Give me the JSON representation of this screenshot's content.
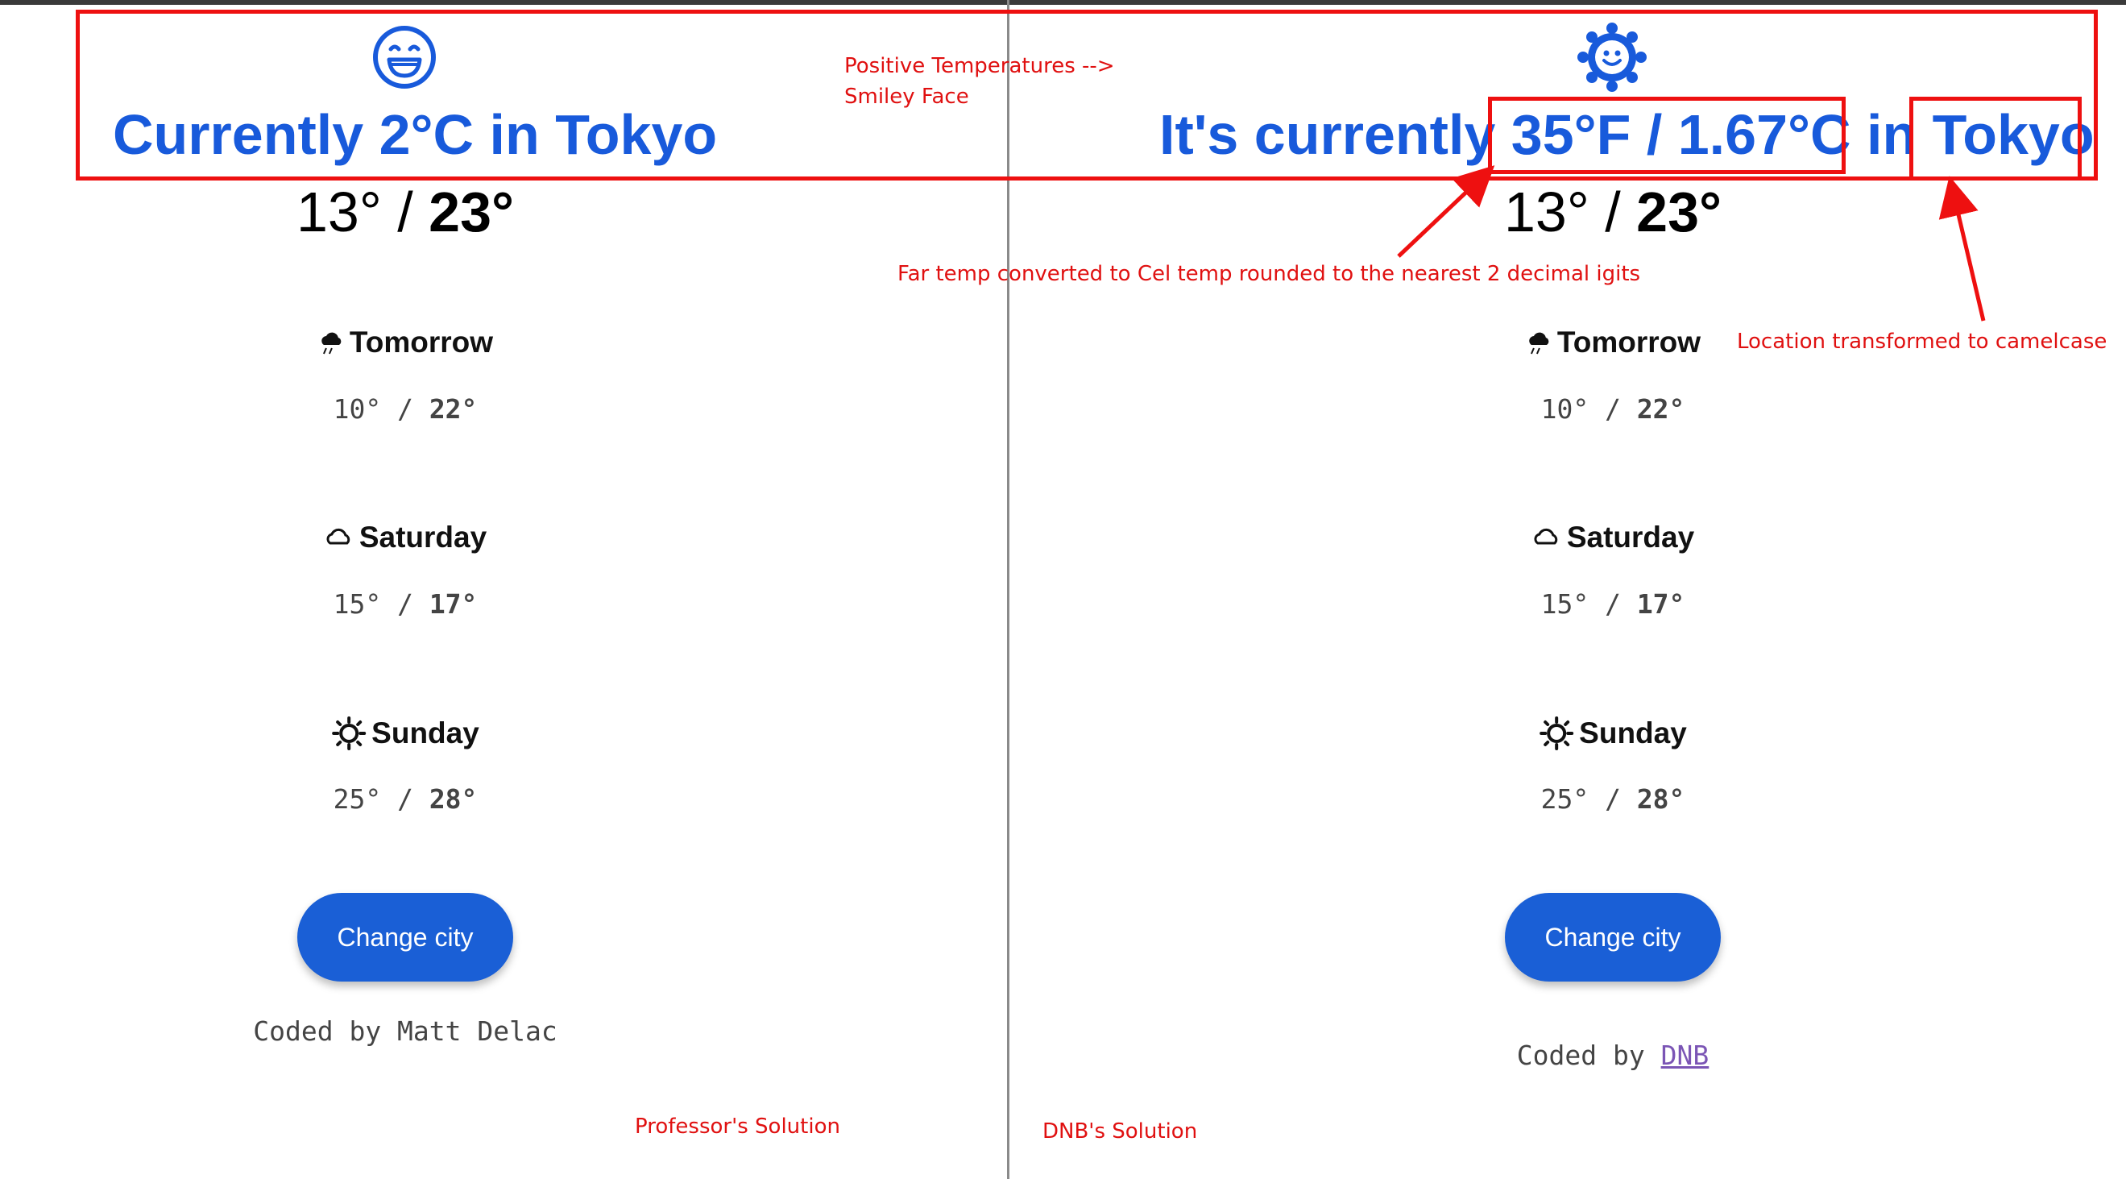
{
  "annotations": {
    "positive_temps": [
      "Positive Temperatures -->",
      "Smiley Face"
    ],
    "conversion_note": "Far temp converted to Cel temp rounded to the nearest 2 decimal igits",
    "location_note": "Location transformed to camelcase",
    "professor_label": "Professor's Solution",
    "dnb_label": "DNB's Solution",
    "color": "#ee1010"
  },
  "left": {
    "icon": "grinning-smiley-icon",
    "headline": "Currently 2°C in Tokyo",
    "today": {
      "low": "13°",
      "sep": "/",
      "high": "23°"
    },
    "forecast": [
      {
        "icon": "rain-cloud-icon",
        "day": "Tomorrow",
        "low": "10°",
        "sep": "/",
        "high": "22°"
      },
      {
        "icon": "cloud-icon",
        "day": "Saturday",
        "low": "15°",
        "sep": "/",
        "high": "17°"
      },
      {
        "icon": "sun-icon",
        "day": "Sunday",
        "low": "25°",
        "sep": "/",
        "high": "28°"
      }
    ],
    "button": "Change city",
    "coded_by": "Coded by Matt Delac"
  },
  "right": {
    "icon": "sun-face-icon",
    "headline_prefix": "It's currently",
    "headline_temp": "35°F / 1.67°C",
    "headline_mid": "in",
    "headline_city": "Tokyo",
    "today": {
      "low": "13°",
      "sep": "/",
      "high": "23°"
    },
    "forecast": [
      {
        "icon": "rain-cloud-icon",
        "day": "Tomorrow",
        "low": "10°",
        "sep": "/",
        "high": "22°"
      },
      {
        "icon": "cloud-icon",
        "day": "Saturday",
        "low": "15°",
        "sep": "/",
        "high": "17°"
      },
      {
        "icon": "sun-icon",
        "day": "Sunday",
        "low": "25°",
        "sep": "/",
        "high": "28°"
      }
    ],
    "button": "Change city",
    "coded_prefix": "Coded by",
    "coded_link": "DNB"
  },
  "colors": {
    "accent": "#185adb",
    "button": "#1a5fd6",
    "link": "#7b55b5"
  }
}
